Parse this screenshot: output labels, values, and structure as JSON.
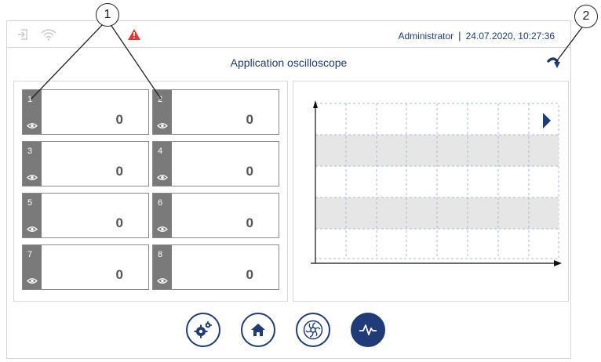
{
  "header": {
    "user": "Administrator",
    "separator": "|",
    "datetime": "24.07.2020, 10:27:36"
  },
  "page": {
    "title": "Application oscilloscope"
  },
  "channels": [
    {
      "number": "1",
      "value": "0"
    },
    {
      "number": "2",
      "value": "0"
    },
    {
      "number": "3",
      "value": "0"
    },
    {
      "number": "4",
      "value": "0"
    },
    {
      "number": "5",
      "value": "0"
    },
    {
      "number": "6",
      "value": "0"
    },
    {
      "number": "7",
      "value": "0"
    },
    {
      "number": "8",
      "value": "0"
    }
  ],
  "nav": {
    "items": [
      {
        "icon": "settings-gears-icon"
      },
      {
        "icon": "home-icon"
      },
      {
        "icon": "fan-icon"
      },
      {
        "icon": "oscilloscope-icon",
        "active": true
      }
    ]
  },
  "callouts": [
    "1",
    "2"
  ],
  "colors": {
    "primary": "#1f3b78",
    "tile_side": "#7a7a7a",
    "warning": "#e53935",
    "band": "#e6e6e6"
  }
}
